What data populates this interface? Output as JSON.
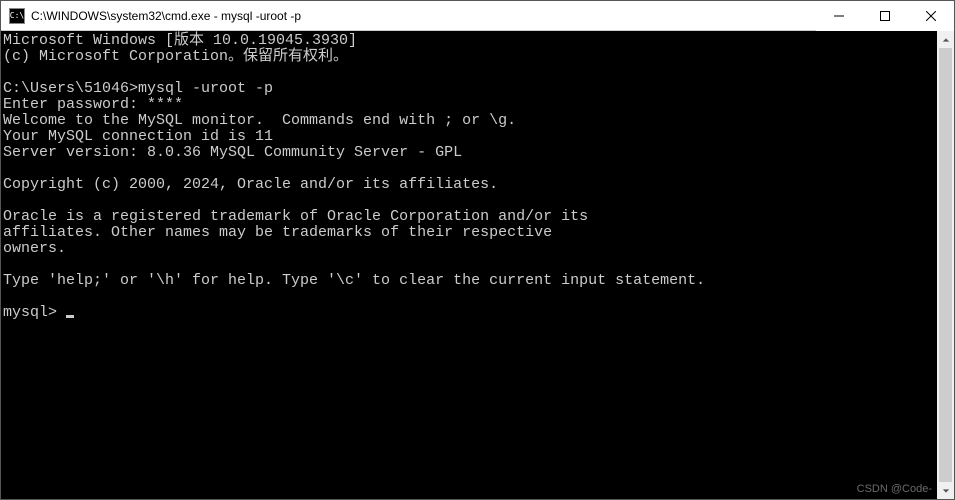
{
  "window": {
    "icon_text": "C:\\",
    "title": "C:\\WINDOWS\\system32\\cmd.exe - mysql  -uroot -p"
  },
  "terminal": {
    "lines": [
      "Microsoft Windows [版本 10.0.19045.3930]",
      "(c) Microsoft Corporation。保留所有权利。",
      "",
      "C:\\Users\\51046>mysql -uroot -p",
      "Enter password: ****",
      "Welcome to the MySQL monitor.  Commands end with ; or \\g.",
      "Your MySQL connection id is 11",
      "Server version: 8.0.36 MySQL Community Server - GPL",
      "",
      "Copyright (c) 2000, 2024, Oracle and/or its affiliates.",
      "",
      "Oracle is a registered trademark of Oracle Corporation and/or its",
      "affiliates. Other names may be trademarks of their respective",
      "owners.",
      "",
      "Type 'help;' or '\\h' for help. Type '\\c' to clear the current input statement.",
      ""
    ],
    "prompt": "mysql> "
  },
  "watermark": "CSDN @Code-"
}
